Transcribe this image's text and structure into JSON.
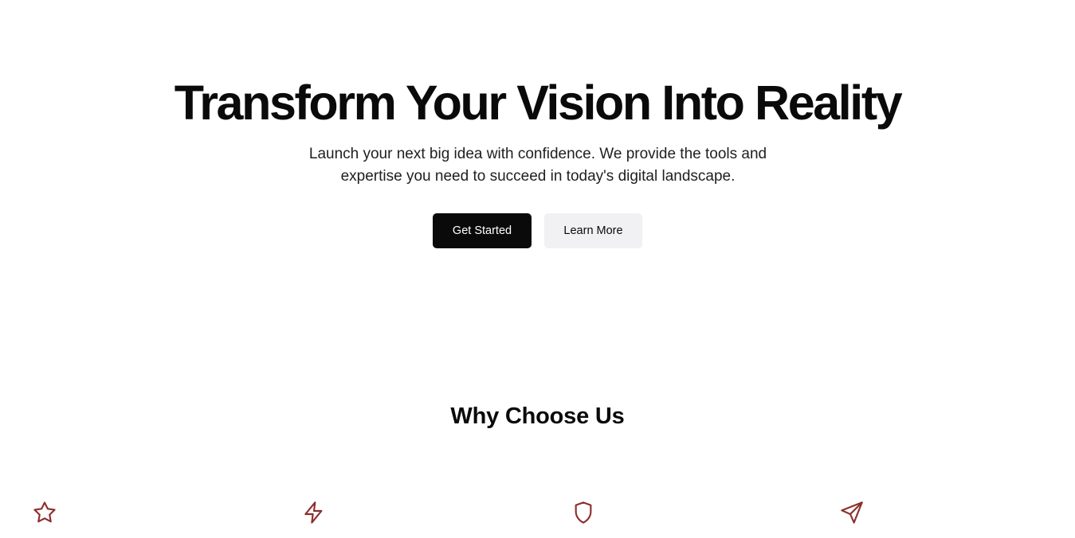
{
  "hero": {
    "title": "Transform Your Vision Into Reality",
    "subtitle": "Launch your next big idea with confidence. We provide the tools and expertise you need to succeed in today's digital landscape.",
    "primary_button": "Get Started",
    "secondary_button": "Learn More"
  },
  "features": {
    "title": "Why Choose Us",
    "icons": [
      "star-icon",
      "lightning-icon",
      "shield-icon",
      "send-icon"
    ],
    "icon_color": "#8b2f2b"
  },
  "colors": {
    "primary_button_bg": "#0a0a0a",
    "secondary_button_bg": "#f1f1f3",
    "text": "#0a0a0a"
  }
}
